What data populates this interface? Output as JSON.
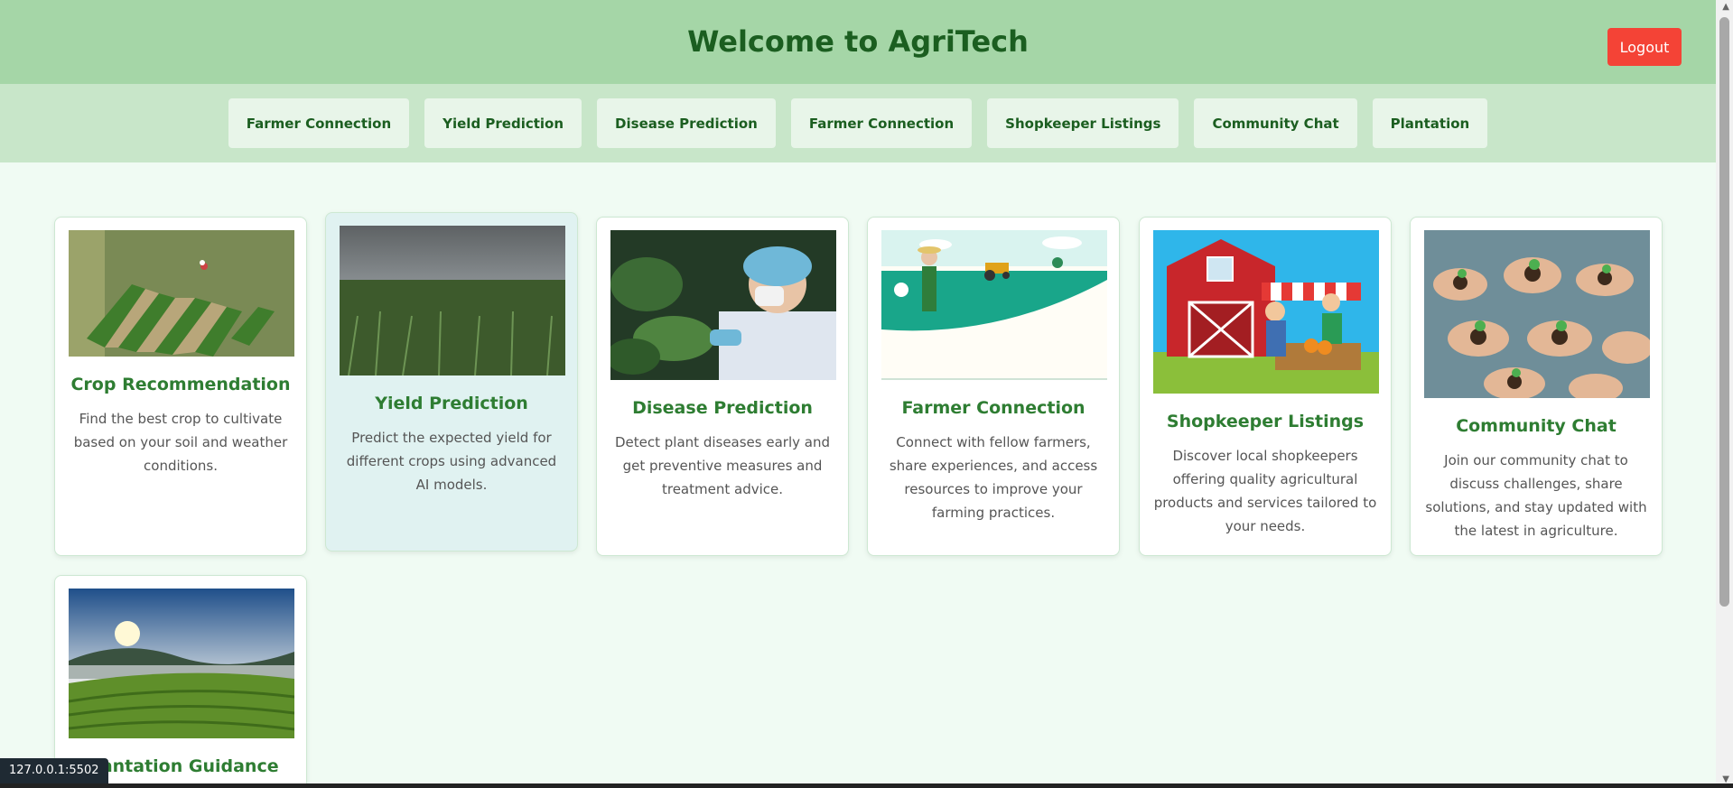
{
  "header": {
    "title": "Welcome to AgriTech",
    "logout_label": "Logout"
  },
  "nav": {
    "items": [
      {
        "label": "Farmer Connection"
      },
      {
        "label": "Yield Prediction"
      },
      {
        "label": "Disease Prediction"
      },
      {
        "label": "Farmer Connection"
      },
      {
        "label": "Shopkeeper Listings"
      },
      {
        "label": "Community Chat"
      },
      {
        "label": "Plantation"
      }
    ]
  },
  "cards": [
    {
      "title": "Crop Recommendation",
      "desc": "Find the best crop to cultivate based on your soil and weather conditions."
    },
    {
      "title": "Yield Prediction",
      "desc": "Predict the expected yield for different crops using advanced AI models."
    },
    {
      "title": "Disease Prediction",
      "desc": "Detect plant diseases early and get preventive measures and treatment advice."
    },
    {
      "title": "Farmer Connection",
      "desc": "Connect with fellow farmers, share experiences, and access resources to improve your farming practices."
    },
    {
      "title": "Shopkeeper Listings",
      "desc": "Discover local shopkeepers offering quality agricultural products and services tailored to your needs."
    },
    {
      "title": "Community Chat",
      "desc": "Join our community chat to discuss challenges, share solutions, and stay updated with the latest in agriculture."
    },
    {
      "title": "Plantation Guidance",
      "desc": ""
    }
  ],
  "status_bar": {
    "url": "127.0.0.1:5502"
  },
  "colors": {
    "header_bg": "#a5d6a7",
    "nav_bg": "#c8e6c9",
    "title_green": "#1b5e20",
    "card_title_green": "#2e7d32",
    "logout_red": "#f44336",
    "page_bg": "#f0fbf3"
  }
}
